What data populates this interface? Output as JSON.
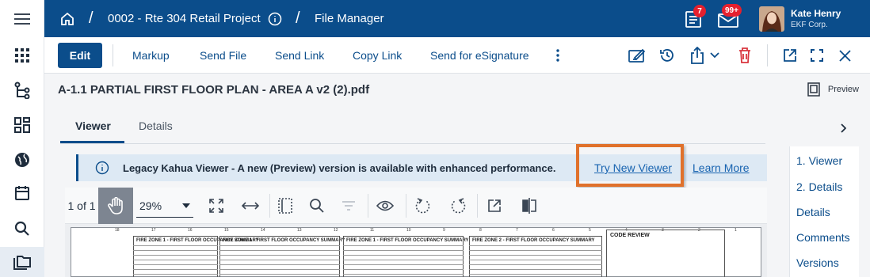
{
  "rail": {
    "items": [
      {
        "name": "menu-icon"
      },
      {
        "name": "apps-grid-icon"
      },
      {
        "name": "hierarchy-icon"
      },
      {
        "name": "dashboard-icon"
      },
      {
        "name": "globe-icon"
      },
      {
        "name": "calendar-icon"
      },
      {
        "name": "search-icon"
      },
      {
        "name": "files-icon"
      }
    ]
  },
  "topbar": {
    "project": "0002 - Rte 304 Retail Project",
    "separator": "/",
    "app": "File Manager",
    "tasks_badge": "7",
    "mail_badge": "99+",
    "user_name": "Kate Henry",
    "user_company": "EKF Corp."
  },
  "toolbar": {
    "edit": "Edit",
    "actions": [
      "Markup",
      "Send File",
      "Send Link",
      "Copy Link",
      "Send for eSignature"
    ]
  },
  "document": {
    "title": "A-1.1 PARTIAL FIRST FLOOR PLAN - AREA A v2 (2).pdf",
    "preview_label": "Preview"
  },
  "tabs": {
    "viewer": "Viewer",
    "details": "Details"
  },
  "banner": {
    "message": "Legacy Kahua Viewer - A new (Preview) version is available with enhanced performance.",
    "try_new": "Try New Viewer",
    "learn_more": "Learn More"
  },
  "viewer": {
    "page_info": "1 of 1",
    "zoom": "29%"
  },
  "sheet": {
    "zones": [
      "FIRE ZONE 1 - FIRST FLOOR OCCUPANCY SUMMARY",
      "FIRE ZONE 1 - FIRST FLOOR OCCUPANCY SUMMARY",
      "FIRE ZONE 1 - FIRST FLOOR OCCUPANCY SUMMARY",
      "FIRE ZONE 2 - FIRST FLOOR OCCUPANCY SUMMARY"
    ],
    "code_review": "CODE REVIEW",
    "grid_numbers": [
      "18",
      "17",
      "16",
      "15",
      "14",
      "13",
      "12",
      "11",
      "10",
      "9",
      "8",
      "7",
      "6",
      "5",
      "4",
      "3",
      "2",
      "1"
    ]
  },
  "side_tabs": [
    "1. Viewer",
    "2. Details",
    "Details",
    "Comments",
    "Versions"
  ],
  "colors": {
    "brand": "#0b4d8b",
    "badge": "#e5202e",
    "highlight": "#e0712b",
    "delete": "#d9363e"
  }
}
